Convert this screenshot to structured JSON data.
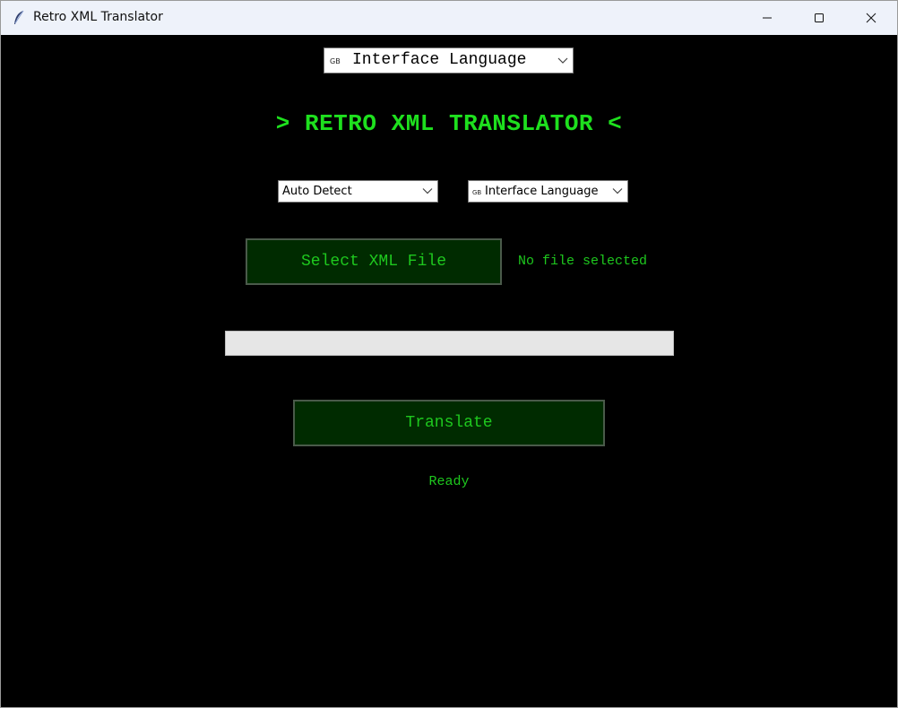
{
  "window": {
    "title": "Retro XML Translator",
    "icon": "feather-icon"
  },
  "interface_language": {
    "flag": "GB",
    "label": "Interface Language"
  },
  "app_title": "> RETRO XML TRANSLATOR <",
  "source_language": {
    "selected": "Auto Detect"
  },
  "target_language": {
    "flag": "GB",
    "selected": "Interface Language"
  },
  "select_file_button": "Select XML File",
  "file_status": "No file selected",
  "progress": {
    "value": 0
  },
  "translate_button": "Translate",
  "status": "Ready",
  "colors": {
    "background": "#000000",
    "accent_green": "#1ee01e",
    "button_bg": "#002b00"
  }
}
